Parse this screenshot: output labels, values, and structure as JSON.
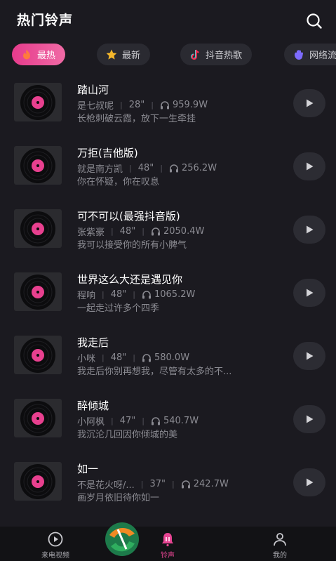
{
  "header": {
    "title": "热门铃声"
  },
  "tabs": [
    {
      "label": "最热",
      "icon": "flame-icon",
      "active": true
    },
    {
      "label": "最新",
      "icon": "star-icon",
      "active": false
    },
    {
      "label": "抖音热歌",
      "icon": "tiktok-icon",
      "active": false
    },
    {
      "label": "网络流",
      "icon": "hand-icon",
      "active": false
    }
  ],
  "songs": [
    {
      "title": "踏山河",
      "artist": "是七叔呢",
      "duration": "28\"",
      "plays": "959.9W",
      "lyric": "长枪刺破云霞，放下一生牵挂"
    },
    {
      "title": "万拒(吉他版)",
      "artist": "就是南方凯",
      "duration": "48\"",
      "plays": "256.2W",
      "lyric": "你在怀疑，你在叹息"
    },
    {
      "title": "可不可以(最强抖音版)",
      "artist": "张紫豪",
      "duration": "48\"",
      "plays": "2050.4W",
      "lyric": "我可以接受你的所有小脾气"
    },
    {
      "title": "世界这么大还是遇见你",
      "artist": "程响",
      "duration": "48\"",
      "plays": "1065.2W",
      "lyric": "一起走过许多个四季"
    },
    {
      "title": "我走后",
      "artist": "小咪",
      "duration": "48\"",
      "plays": "580.0W",
      "lyric": "我走后你别再想我，尽管有太多的不..."
    },
    {
      "title": "醉倾城",
      "artist": "小阿枫",
      "duration": "47\"",
      "plays": "540.7W",
      "lyric": "我沉沦几回因你倾城的美"
    },
    {
      "title": "如一",
      "artist": "不是花火呀/...",
      "duration": "37\"",
      "plays": "242.7W",
      "lyric": "画岁月依旧待你如一"
    }
  ],
  "bottom_nav": [
    {
      "label": "来电视频",
      "icon": "play-circle-icon",
      "active": false
    },
    {
      "label": "铃声",
      "icon": "bell-icon",
      "active": true
    },
    {
      "label": "我的",
      "icon": "person-icon",
      "active": false
    }
  ],
  "colors": {
    "accent": "#e74593",
    "background": "#1b1a20",
    "disc_center": "#e8408f"
  }
}
